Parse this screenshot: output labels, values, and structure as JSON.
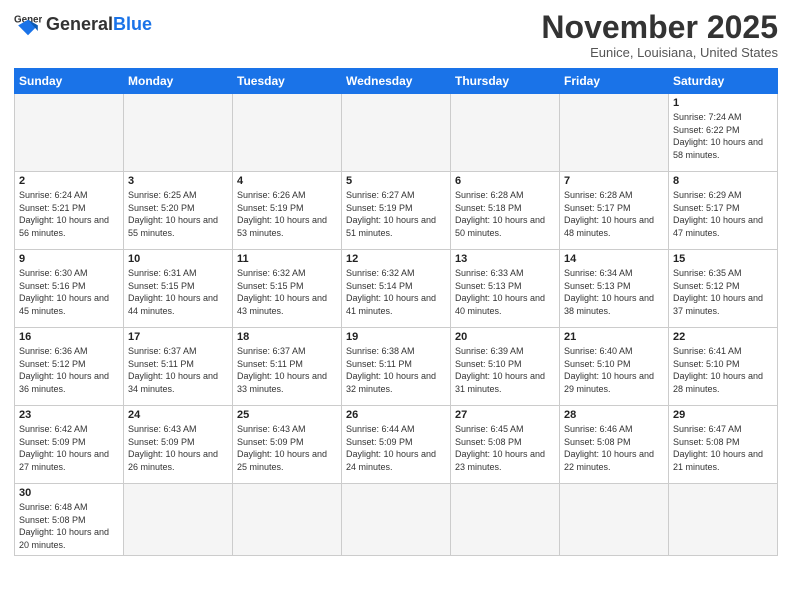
{
  "header": {
    "logo_general": "General",
    "logo_blue": "Blue",
    "month_title": "November 2025",
    "location": "Eunice, Louisiana, United States"
  },
  "weekdays": [
    "Sunday",
    "Monday",
    "Tuesday",
    "Wednesday",
    "Thursday",
    "Friday",
    "Saturday"
  ],
  "days": [
    {
      "num": "",
      "info": ""
    },
    {
      "num": "",
      "info": ""
    },
    {
      "num": "",
      "info": ""
    },
    {
      "num": "",
      "info": ""
    },
    {
      "num": "",
      "info": ""
    },
    {
      "num": "",
      "info": ""
    },
    {
      "num": "1",
      "info": "Sunrise: 7:24 AM\nSunset: 6:22 PM\nDaylight: 10 hours\nand 58 minutes."
    },
    {
      "num": "2",
      "info": "Sunrise: 6:24 AM\nSunset: 5:21 PM\nDaylight: 10 hours\nand 56 minutes."
    },
    {
      "num": "3",
      "info": "Sunrise: 6:25 AM\nSunset: 5:20 PM\nDaylight: 10 hours\nand 55 minutes."
    },
    {
      "num": "4",
      "info": "Sunrise: 6:26 AM\nSunset: 5:19 PM\nDaylight: 10 hours\nand 53 minutes."
    },
    {
      "num": "5",
      "info": "Sunrise: 6:27 AM\nSunset: 5:19 PM\nDaylight: 10 hours\nand 51 minutes."
    },
    {
      "num": "6",
      "info": "Sunrise: 6:28 AM\nSunset: 5:18 PM\nDaylight: 10 hours\nand 50 minutes."
    },
    {
      "num": "7",
      "info": "Sunrise: 6:28 AM\nSunset: 5:17 PM\nDaylight: 10 hours\nand 48 minutes."
    },
    {
      "num": "8",
      "info": "Sunrise: 6:29 AM\nSunset: 5:17 PM\nDaylight: 10 hours\nand 47 minutes."
    },
    {
      "num": "9",
      "info": "Sunrise: 6:30 AM\nSunset: 5:16 PM\nDaylight: 10 hours\nand 45 minutes."
    },
    {
      "num": "10",
      "info": "Sunrise: 6:31 AM\nSunset: 5:15 PM\nDaylight: 10 hours\nand 44 minutes."
    },
    {
      "num": "11",
      "info": "Sunrise: 6:32 AM\nSunset: 5:15 PM\nDaylight: 10 hours\nand 43 minutes."
    },
    {
      "num": "12",
      "info": "Sunrise: 6:32 AM\nSunset: 5:14 PM\nDaylight: 10 hours\nand 41 minutes."
    },
    {
      "num": "13",
      "info": "Sunrise: 6:33 AM\nSunset: 5:13 PM\nDaylight: 10 hours\nand 40 minutes."
    },
    {
      "num": "14",
      "info": "Sunrise: 6:34 AM\nSunset: 5:13 PM\nDaylight: 10 hours\nand 38 minutes."
    },
    {
      "num": "15",
      "info": "Sunrise: 6:35 AM\nSunset: 5:12 PM\nDaylight: 10 hours\nand 37 minutes."
    },
    {
      "num": "16",
      "info": "Sunrise: 6:36 AM\nSunset: 5:12 PM\nDaylight: 10 hours\nand 36 minutes."
    },
    {
      "num": "17",
      "info": "Sunrise: 6:37 AM\nSunset: 5:11 PM\nDaylight: 10 hours\nand 34 minutes."
    },
    {
      "num": "18",
      "info": "Sunrise: 6:37 AM\nSunset: 5:11 PM\nDaylight: 10 hours\nand 33 minutes."
    },
    {
      "num": "19",
      "info": "Sunrise: 6:38 AM\nSunset: 5:11 PM\nDaylight: 10 hours\nand 32 minutes."
    },
    {
      "num": "20",
      "info": "Sunrise: 6:39 AM\nSunset: 5:10 PM\nDaylight: 10 hours\nand 31 minutes."
    },
    {
      "num": "21",
      "info": "Sunrise: 6:40 AM\nSunset: 5:10 PM\nDaylight: 10 hours\nand 29 minutes."
    },
    {
      "num": "22",
      "info": "Sunrise: 6:41 AM\nSunset: 5:10 PM\nDaylight: 10 hours\nand 28 minutes."
    },
    {
      "num": "23",
      "info": "Sunrise: 6:42 AM\nSunset: 5:09 PM\nDaylight: 10 hours\nand 27 minutes."
    },
    {
      "num": "24",
      "info": "Sunrise: 6:43 AM\nSunset: 5:09 PM\nDaylight: 10 hours\nand 26 minutes."
    },
    {
      "num": "25",
      "info": "Sunrise: 6:43 AM\nSunset: 5:09 PM\nDaylight: 10 hours\nand 25 minutes."
    },
    {
      "num": "26",
      "info": "Sunrise: 6:44 AM\nSunset: 5:09 PM\nDaylight: 10 hours\nand 24 minutes."
    },
    {
      "num": "27",
      "info": "Sunrise: 6:45 AM\nSunset: 5:08 PM\nDaylight: 10 hours\nand 23 minutes."
    },
    {
      "num": "28",
      "info": "Sunrise: 6:46 AM\nSunset: 5:08 PM\nDaylight: 10 hours\nand 22 minutes."
    },
    {
      "num": "29",
      "info": "Sunrise: 6:47 AM\nSunset: 5:08 PM\nDaylight: 10 hours\nand 21 minutes."
    },
    {
      "num": "30",
      "info": "Sunrise: 6:48 AM\nSunset: 5:08 PM\nDaylight: 10 hours\nand 20 minutes."
    },
    {
      "num": "",
      "info": ""
    },
    {
      "num": "",
      "info": ""
    },
    {
      "num": "",
      "info": ""
    },
    {
      "num": "",
      "info": ""
    },
    {
      "num": "",
      "info": ""
    },
    {
      "num": "",
      "info": ""
    }
  ]
}
